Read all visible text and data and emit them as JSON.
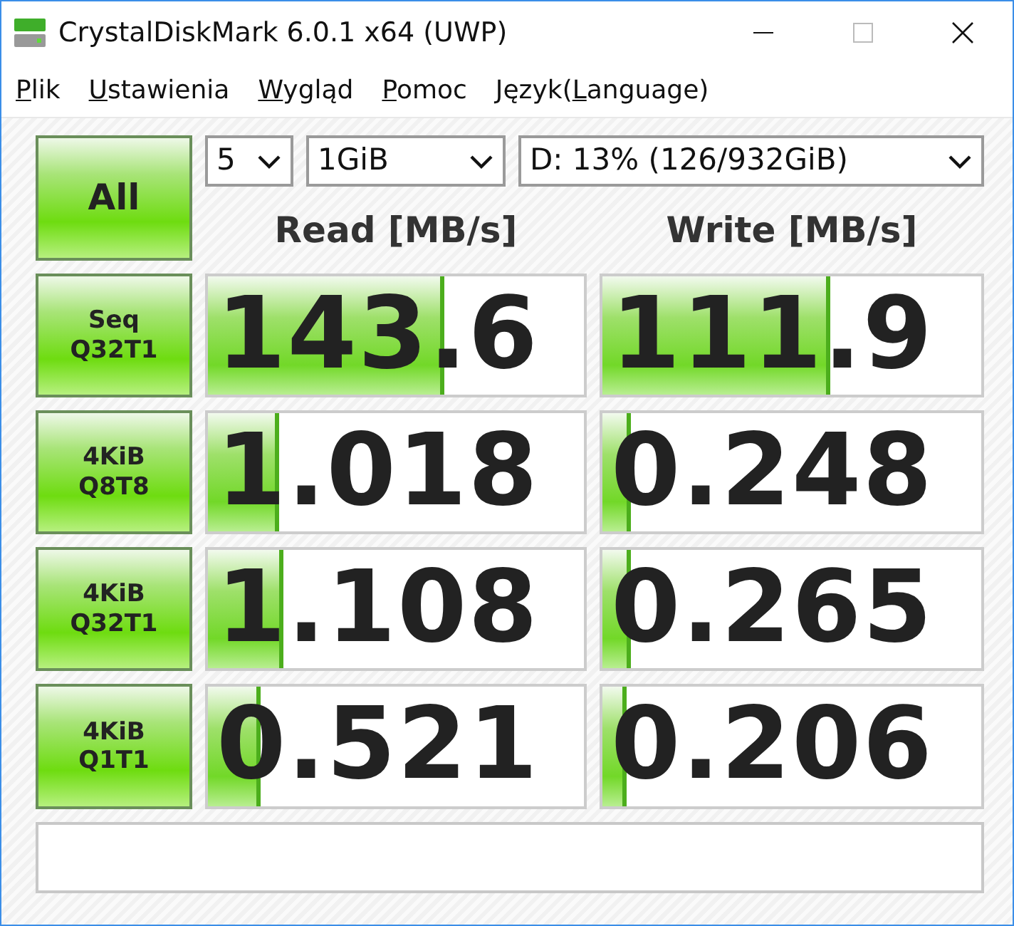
{
  "window": {
    "title": "CrystalDiskMark 6.0.1 x64 (UWP)"
  },
  "menu": [
    {
      "key": "P",
      "after": "lik"
    },
    {
      "key": "U",
      "after": "stawienia"
    },
    {
      "key": "W",
      "after": "ygląd"
    },
    {
      "key": "P",
      "after": "omoc"
    },
    {
      "before": "Język(",
      "key": "L",
      "after": "anguage)"
    }
  ],
  "all_button": "All",
  "selects": [
    {
      "value": "5"
    },
    {
      "value": "1GiB"
    },
    {
      "value": "D: 13% (126/932GiB)"
    }
  ],
  "headers": [
    "Read [MB/s]",
    "Write [MB/s]"
  ],
  "tests": [
    {
      "label": [
        "Seq",
        "Q32T1"
      ],
      "read": {
        "value": "143.6",
        "level": 0.63
      },
      "write": {
        "value": "111.9",
        "level": 0.6
      }
    },
    {
      "label": [
        "4KiB",
        "Q8T8"
      ],
      "read": {
        "value": "1.018",
        "level": 0.19
      },
      "write": {
        "value": "0.248",
        "level": 0.075
      }
    },
    {
      "label": [
        "4KiB",
        "Q32T1"
      ],
      "read": {
        "value": "1.108",
        "level": 0.2
      },
      "write": {
        "value": "0.265",
        "level": 0.075
      }
    },
    {
      "label": [
        "4KiB",
        "Q1T1"
      ],
      "read": {
        "value": "0.521",
        "level": 0.14
      },
      "write": {
        "value": "0.206",
        "level": 0.065
      }
    }
  ]
}
